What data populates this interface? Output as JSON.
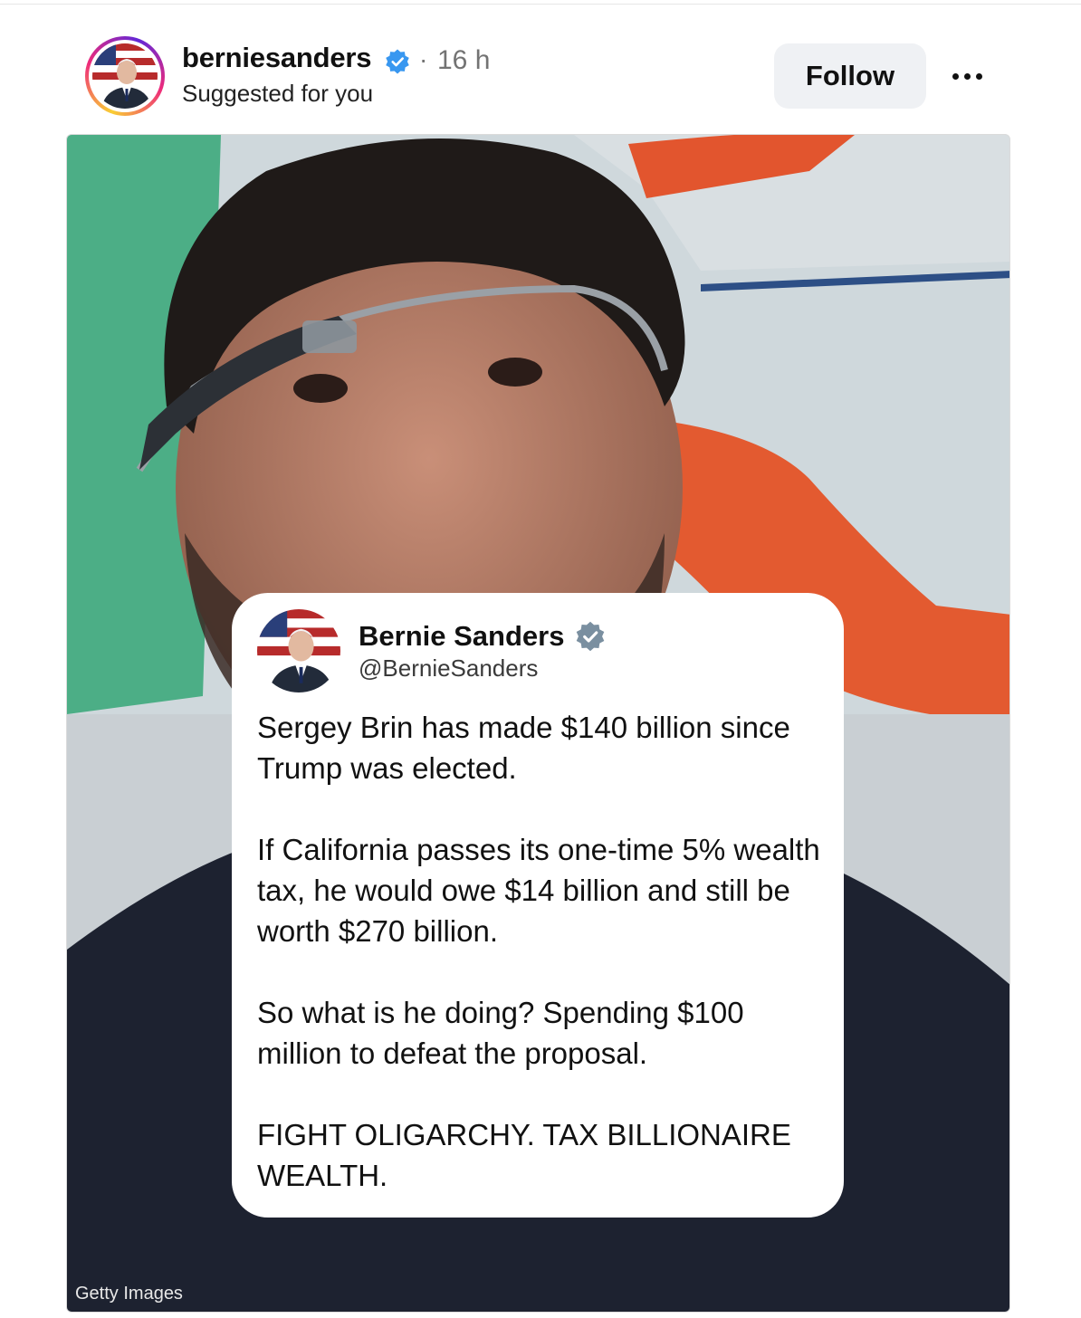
{
  "header": {
    "username": "berniesanders",
    "separator": "·",
    "time": "16 h",
    "subtitle": "Suggested for you",
    "follow_label": "Follow",
    "more_icon": "more-horizontal-icon",
    "verified_icon": "verified-badge-icon"
  },
  "post": {
    "image_credit": "Getty Images",
    "tweet": {
      "name": "Bernie Sanders",
      "handle": "@BernieSanders",
      "paragraphs": [
        "Sergey Brin has made $140 billion since Trump was elected.",
        "If California passes its one-time 5% wealth tax, he would owe $14 billion and still be worth $270 billion.",
        "So what is he doing? Spending $100 million to defeat the proposal.",
        "FIGHT OLIGARCHY. TAX BILLIONAIRE WEALTH."
      ]
    }
  },
  "colors": {
    "verified_blue": "#3897f0",
    "tweet_verified": "#7a8fa0",
    "follow_bg": "#eff1f4",
    "muted_text": "#737373"
  }
}
